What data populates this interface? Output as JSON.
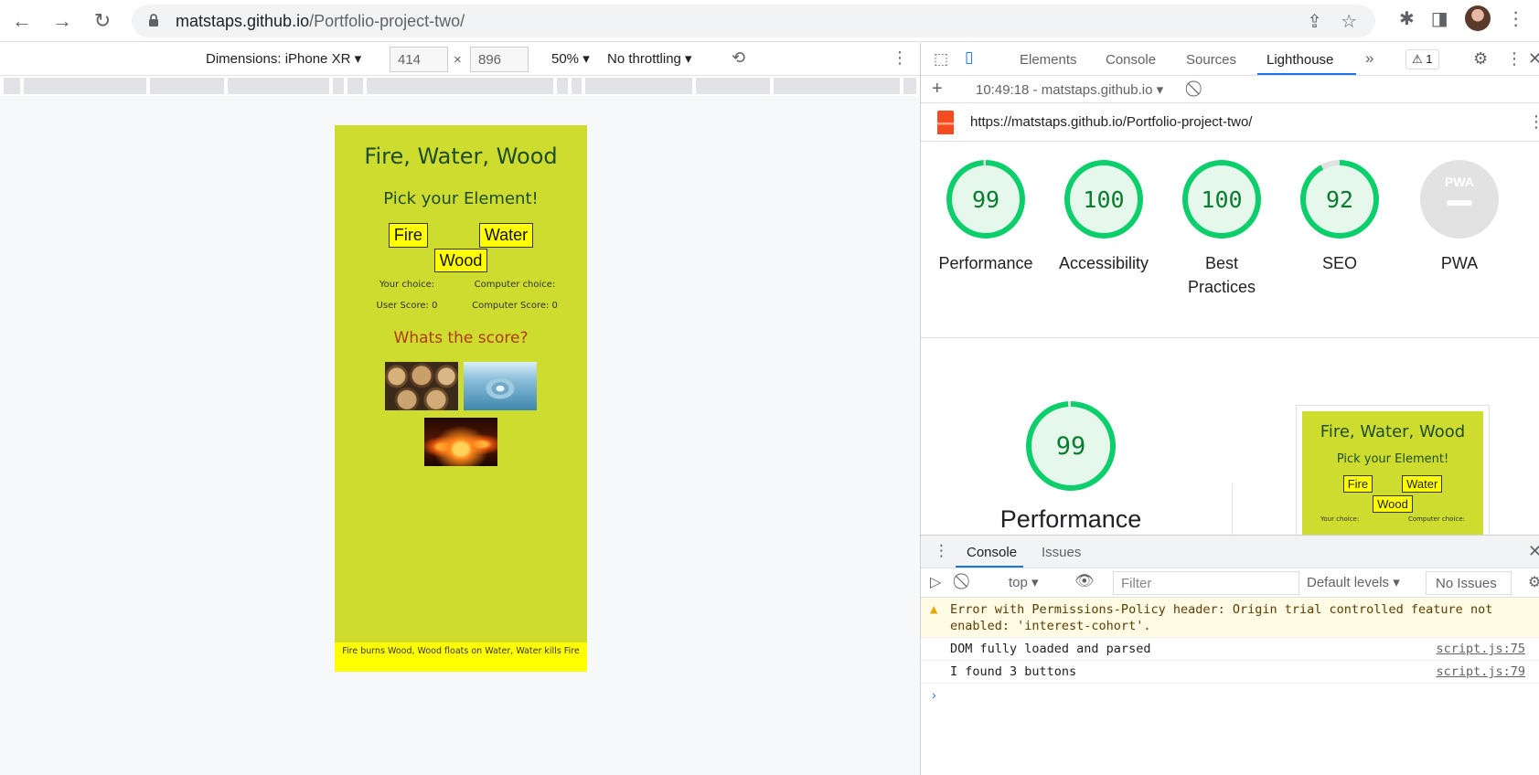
{
  "browser": {
    "url_host": "matstaps.github.io",
    "url_path": "/Portfolio-project-two/"
  },
  "device_toolbar": {
    "dimensions_label": "Dimensions: iPhone XR",
    "width": "414",
    "height": "896",
    "times": "×",
    "zoom": "50%",
    "throttling": "No throttling"
  },
  "phone": {
    "title": "Fire, Water, Wood",
    "subtitle": "Pick your Element!",
    "buttons": [
      "Fire",
      "Water",
      "Wood"
    ],
    "your_choice": "Your choice:",
    "computer_choice": "Computer choice:",
    "user_score": "User Score: 0",
    "computer_score": "Computer Score: 0",
    "score_heading": "Whats the score?",
    "footer": "Fire burns Wood, Wood floats on Water, Water kills Fire"
  },
  "devtools": {
    "tabs": [
      "Elements",
      "Console",
      "Sources",
      "Lighthouse"
    ],
    "more": "»",
    "warning_count": "⚠ 1",
    "report_selector": "10:49:18 - matstaps.github.io",
    "audited_url": "https://matstaps.github.io/Portfolio-project-two/",
    "scores": [
      {
        "value": "99",
        "label": "Performance"
      },
      {
        "value": "100",
        "label": "Accessibility"
      },
      {
        "value": "100",
        "label": "Best Practices"
      },
      {
        "value": "92",
        "label": "SEO"
      }
    ],
    "pwa_label": "PWA",
    "pwa_badge": "PWA",
    "performance_score": "99",
    "performance_title": "Performance",
    "thumb": {
      "title": "Fire, Water, Wood",
      "subtitle": "Pick your Element!",
      "buttons": [
        "Fire",
        "Water",
        "Wood"
      ],
      "your_choice": "Your choice:",
      "computer_choice": "Computer choice:"
    },
    "colors": {
      "pass": "#0cce6b",
      "pass_text": "#0a7c2f",
      "accent": "#1a73e8"
    }
  },
  "console": {
    "tabs": [
      "Console",
      "Issues"
    ],
    "context": "top",
    "filter_placeholder": "Filter",
    "levels": "Default levels",
    "no_issues": "No Issues",
    "messages": [
      {
        "type": "warning",
        "text": "Error with Permissions-Policy header: Origin trial controlled feature not enabled: 'interest-cohort'.",
        "source": ""
      },
      {
        "type": "log",
        "text": "DOM fully loaded and parsed",
        "source": "script.js:75"
      },
      {
        "type": "log",
        "text": "I found 3 buttons",
        "source": "script.js:79"
      }
    ],
    "prompt": "›"
  }
}
